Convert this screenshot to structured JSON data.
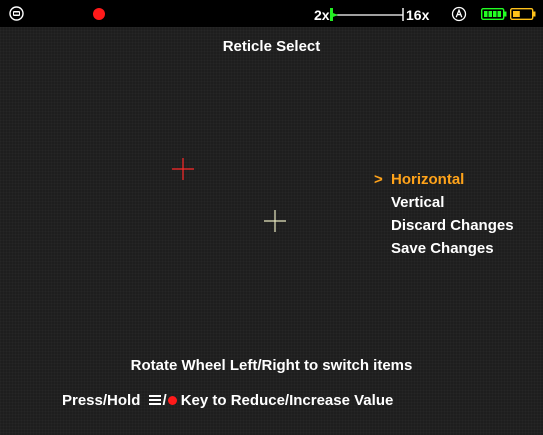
{
  "status_bar": {
    "zoom_min": "2x",
    "zoom_max": "16x",
    "zoom_level_fraction": 0.0,
    "recording_color": "#ff1a1a",
    "external_battery": {
      "segments_filled": 4,
      "segments_total": 4,
      "color": "#22ff22"
    },
    "internal_battery": {
      "level_fraction": 0.4,
      "color": "#ffc21a"
    },
    "icons": [
      "sig-logo-icon",
      "record-icon",
      "zoom-slider",
      "auto-mode-icon",
      "external-battery-icon",
      "internal-battery-icon"
    ]
  },
  "screen": {
    "title": "Reticle Select"
  },
  "reticles": {
    "active_color": "#ff2a2a",
    "reference_color": "#e8e8c0"
  },
  "menu": {
    "cursor": ">",
    "selected_color": "#ffa31a",
    "items": [
      {
        "label": "Horizontal",
        "selected": true
      },
      {
        "label": "Vertical",
        "selected": false
      },
      {
        "label": "Discard Changes",
        "selected": false
      },
      {
        "label": "Save Changes",
        "selected": false
      }
    ]
  },
  "hints": {
    "line1": "Rotate Wheel Left/Right to switch items",
    "line2_prefix": "Press/Hold",
    "line2_separator": "/",
    "line2_suffix": "Key to Reduce/Increase Value"
  }
}
